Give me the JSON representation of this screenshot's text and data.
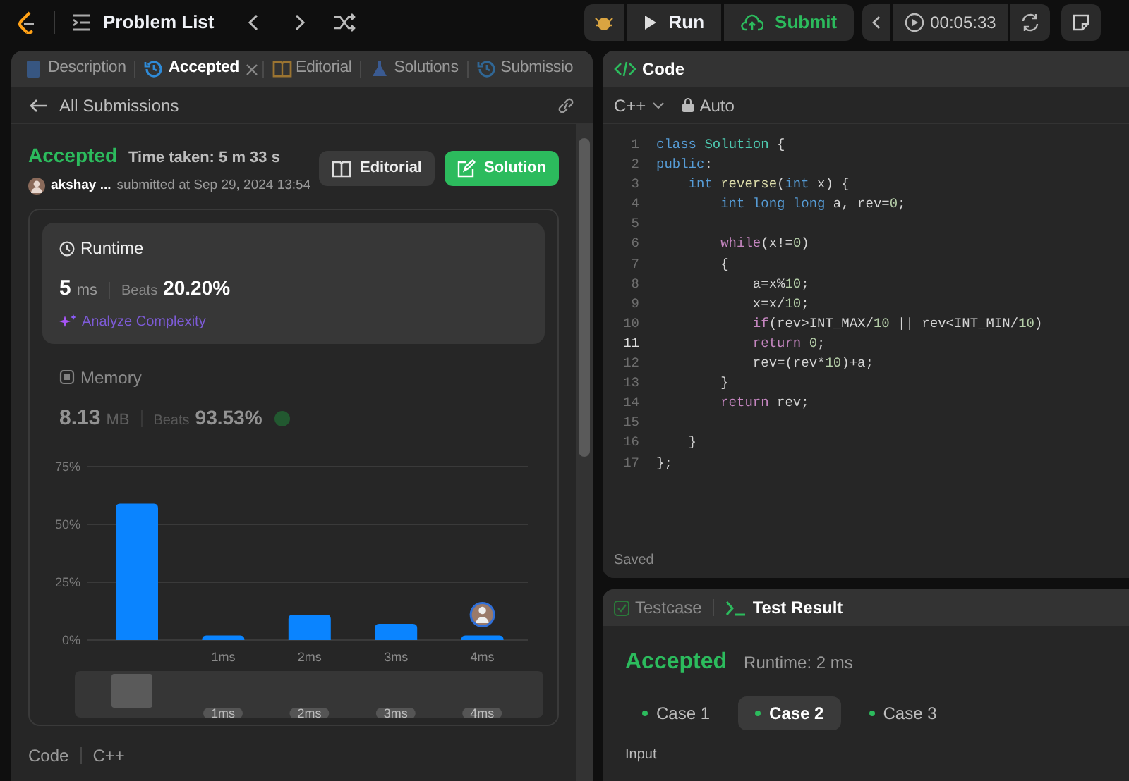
{
  "top_bar": {
    "problem_list": "Problem List",
    "run": "Run",
    "submit": "Submit",
    "timer": "00:05:33"
  },
  "tabs": [
    {
      "kind": "description",
      "label": "Description",
      "selected": false
    },
    {
      "kind": "history",
      "label": "Accepted",
      "selected": true,
      "closable": true
    },
    {
      "kind": "book",
      "label": "Editorial",
      "selected": false
    },
    {
      "kind": "flask",
      "label": "Solutions",
      "selected": false
    },
    {
      "kind": "history",
      "label": "Submissio",
      "selected": false
    }
  ],
  "back_link": "All Submissions",
  "submission": {
    "status": "Accepted",
    "time_taken": "Time taken: 5 m 33 s",
    "user": "akshay ...",
    "submitted": "submitted at Sep 29, 2024 13:54",
    "buttons": [
      {
        "kind": "editorial",
        "label": "Editorial"
      },
      {
        "kind": "solution",
        "label": "Solution"
      }
    ]
  },
  "metrics": [
    {
      "kind": "runtime",
      "title": "Runtime",
      "value": "5",
      "unit": "ms",
      "beats_label": "Beats",
      "beats": "20.20%",
      "selected": true,
      "link": "Analyze Complexity"
    },
    {
      "kind": "memory",
      "title": "Memory",
      "value": "8.13",
      "unit": "MB",
      "beats_label": "Beats",
      "beats": "93.53%",
      "selected": false
    }
  ],
  "chart_data": {
    "type": "bar",
    "categories": [
      null,
      "1ms",
      "2ms",
      "3ms",
      "4ms"
    ],
    "series": [
      {
        "color": "#0a84ff",
        "values": [
          59,
          2,
          11,
          7,
          2
        ]
      }
    ],
    "ylim": [
      0,
      75
    ],
    "yticks": [
      {
        "value": 0,
        "label": "0%"
      },
      {
        "value": 25,
        "label": "25%"
      },
      {
        "value": 50,
        "label": "50%"
      },
      {
        "value": 75,
        "label": "75%"
      }
    ]
  },
  "overview_labels": [
    "1ms",
    "2ms",
    "3ms",
    "4ms"
  ],
  "code_footer": {
    "label": "Code",
    "language": "C++"
  },
  "editor": {
    "title": "Code",
    "language": "C++",
    "mode": "Auto",
    "status": "Saved",
    "lines": [
      {
        "n": "1",
        "active": false,
        "tokens": [
          {
            "kind": "kw",
            "text": "class "
          },
          {
            "kind": "cls",
            "text": "Solution"
          },
          {
            "kind": "txt",
            "text": " {"
          }
        ]
      },
      {
        "n": "2",
        "active": false,
        "tokens": [
          {
            "kind": "kw",
            "text": "public"
          },
          {
            "kind": "txt",
            "text": ":"
          }
        ]
      },
      {
        "n": "3",
        "active": false,
        "tokens": [
          {
            "kind": "kw",
            "text": "    int "
          },
          {
            "kind": "fn",
            "text": "reverse"
          },
          {
            "kind": "txt",
            "text": "("
          },
          {
            "kind": "kw",
            "text": "int"
          },
          {
            "kind": "txt",
            "text": " x) {"
          }
        ]
      },
      {
        "n": "4",
        "active": false,
        "tokens": [
          {
            "kind": "kw",
            "text": "        int long long"
          },
          {
            "kind": "txt",
            "text": " a, rev="
          },
          {
            "kind": "num",
            "text": "0"
          },
          {
            "kind": "txt",
            "text": ";"
          }
        ]
      },
      {
        "n": "5",
        "active": false
      },
      {
        "n": "6",
        "active": false,
        "tokens": [
          {
            "kind": "ctl",
            "text": "        while"
          },
          {
            "kind": "txt",
            "text": "(x!="
          },
          {
            "kind": "num",
            "text": "0"
          },
          {
            "kind": "txt",
            "text": ")"
          }
        ]
      },
      {
        "n": "7",
        "active": false,
        "tokens": [
          {
            "kind": "txt",
            "text": "        {"
          }
        ]
      },
      {
        "n": "8",
        "active": false,
        "tokens": [
          {
            "kind": "txt",
            "text": "            a=x%"
          },
          {
            "kind": "num",
            "text": "10"
          },
          {
            "kind": "txt",
            "text": ";"
          }
        ]
      },
      {
        "n": "9",
        "active": false,
        "tokens": [
          {
            "kind": "txt",
            "text": "            x=x/"
          },
          {
            "kind": "num",
            "text": "10"
          },
          {
            "kind": "txt",
            "text": ";"
          }
        ]
      },
      {
        "n": "10",
        "active": false,
        "tokens": [
          {
            "kind": "ctl",
            "text": "            if"
          },
          {
            "kind": "txt",
            "text": "(rev>INT_MAX/"
          },
          {
            "kind": "num",
            "text": "10"
          },
          {
            "kind": "txt",
            "text": " || rev<INT_MIN/"
          },
          {
            "kind": "num",
            "text": "10"
          },
          {
            "kind": "txt",
            "text": ")"
          }
        ]
      },
      {
        "n": "11",
        "active": true,
        "tokens": [
          {
            "kind": "ctl",
            "text": "            return "
          },
          {
            "kind": "num",
            "text": "0"
          },
          {
            "kind": "txt",
            "text": ";"
          }
        ]
      },
      {
        "n": "12",
        "active": false,
        "tokens": [
          {
            "kind": "txt",
            "text": "            rev=(rev*"
          },
          {
            "kind": "num",
            "text": "10"
          },
          {
            "kind": "txt",
            "text": ")+a;"
          }
        ]
      },
      {
        "n": "13",
        "active": false,
        "tokens": [
          {
            "kind": "txt",
            "text": "        }"
          }
        ]
      },
      {
        "n": "14",
        "active": false,
        "tokens": [
          {
            "kind": "ctl",
            "text": "        return "
          },
          {
            "kind": "txt",
            "text": "rev;"
          }
        ]
      },
      {
        "n": "15",
        "active": false
      },
      {
        "n": "16",
        "active": false,
        "tokens": [
          {
            "kind": "txt",
            "text": "    }"
          }
        ]
      },
      {
        "n": "17",
        "active": false,
        "tokens": [
          {
            "kind": "txt",
            "text": "};"
          }
        ]
      }
    ]
  },
  "test_panel": {
    "tabs": [
      {
        "kind": "testcase",
        "label": "Testcase",
        "selected": false
      },
      {
        "kind": "result",
        "label": "Test Result",
        "selected": true
      }
    ],
    "status": "Accepted",
    "runtime": "Runtime: 2 ms",
    "cases": [
      {
        "label": "Case 1",
        "selected": false
      },
      {
        "label": "Case 2",
        "selected": true
      },
      {
        "label": "Case 3",
        "selected": false
      }
    ],
    "input_label": "Input"
  }
}
